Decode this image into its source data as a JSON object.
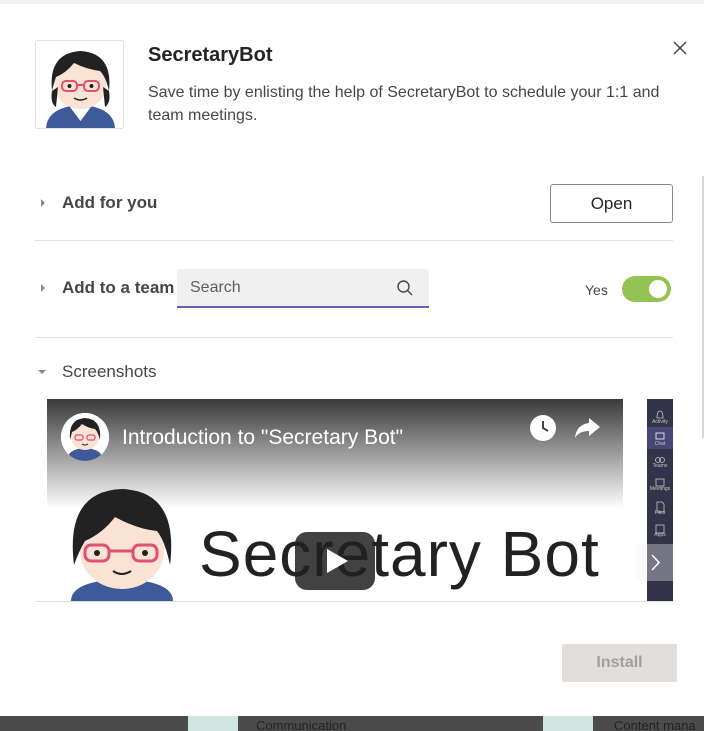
{
  "app": {
    "name": "SecretaryBot",
    "description": "Save time by enlisting the help of SecretaryBot to schedule your 1:1 and team meetings."
  },
  "add_for_you": {
    "label": "Add for you",
    "button_label": "Open"
  },
  "add_to_team": {
    "label": "Add to a team",
    "search_placeholder": "Search",
    "toggle_label": "Yes",
    "toggle_on": true,
    "toggle_color": "#92c353"
  },
  "screenshots": {
    "label": "Screenshots",
    "video_title": "Introduction to \"Secretary Bot\"",
    "video_banner_text": "Secretary Bot",
    "thumbnail_nav": [
      "Activity",
      "Chat",
      "Teams",
      "Meetings",
      "Files",
      "Apps"
    ]
  },
  "footer": {
    "install_label": "Install",
    "install_enabled": false
  },
  "background": {
    "bottom_labels": [
      "Communication",
      "Content mana"
    ]
  },
  "colors": {
    "accent": "#6264a7",
    "toggle_on": "#92c353",
    "text_primary": "#252423",
    "text_secondary": "#484644"
  },
  "icons": {
    "close": "close-icon",
    "search": "search-icon",
    "expand": "chevron-right-icon",
    "collapse": "chevron-down-icon",
    "clock": "clock-icon",
    "share": "share-icon",
    "play": "play-icon",
    "next": "chevron-right-icon"
  }
}
